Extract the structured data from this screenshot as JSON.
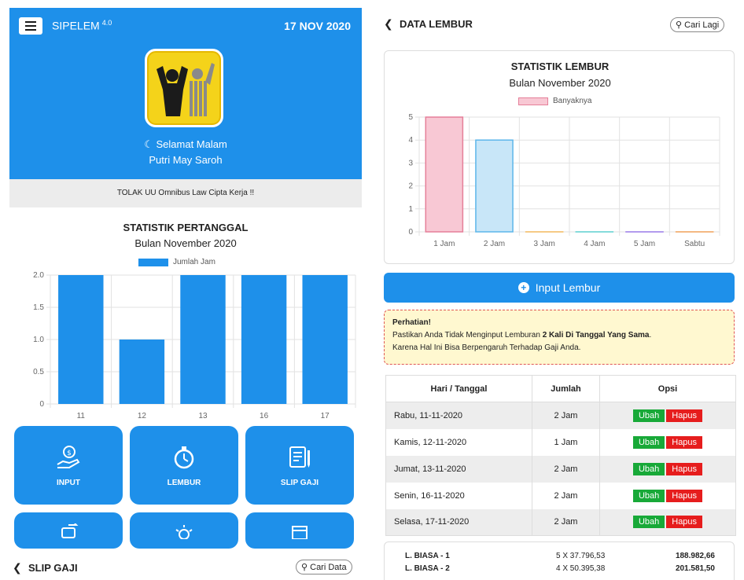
{
  "left": {
    "app_name": "SIPELEM",
    "app_version": "4.0",
    "date": "17 NOV 2020",
    "greeting": "Selamat Malam",
    "user_name": "Putri May Saroh",
    "banner": "TOLAK UU Omnibus Law Cipta Kerja !!",
    "tiles": [
      "INPUT",
      "LEMBUR",
      "SLIP GAJI"
    ],
    "slip_title": "SLIP GAJI",
    "search_label": "Cari Data"
  },
  "right": {
    "title": "DATA LEMBUR",
    "search_label": "Cari Lagi",
    "input_button": "Input Lembur",
    "warning": {
      "title": "Perhatian!",
      "text_before": "Pastikan Anda Tidak Menginput Lemburan ",
      "text_bold": "2 Kali Di Tanggal Yang Sama",
      "text_after": ".",
      "line2": "Karena Hal Ini Bisa Berpengaruh Terhadap Gaji Anda."
    },
    "table": {
      "headers": [
        "Hari / Tanggal",
        "Jumlah",
        "Opsi"
      ],
      "rows": [
        {
          "date": "Rabu, 11-11-2020",
          "amount": "2 Jam"
        },
        {
          "date": "Kamis, 12-11-2020",
          "amount": "1 Jam"
        },
        {
          "date": "Jumat, 13-11-2020",
          "amount": "2 Jam"
        },
        {
          "date": "Senin, 16-11-2020",
          "amount": "2 Jam"
        },
        {
          "date": "Selasa, 17-11-2020",
          "amount": "2 Jam"
        }
      ],
      "edit_label": "Ubah",
      "delete_label": "Hapus"
    },
    "summary": [
      {
        "label": "L. BIASA - 1",
        "calc": "5 X 37.796,53",
        "total": "188.982,66"
      },
      {
        "label": "L. BIASA - 2",
        "calc": "4 X 50.395,38",
        "total": "201.581,50"
      }
    ]
  },
  "colors": {
    "primary": "#1e90ea",
    "logo_yellow": "#f4d31a",
    "success": "#18a938",
    "danger": "#e61d1d",
    "bar_pink": "#f8c8d4",
    "bar_blue": "#c8e6f8"
  },
  "icons": {
    "menu": "hamburger-icon",
    "moon": "moon-icon",
    "back": "chevron-left-icon",
    "search": "search-icon",
    "plus": "plus-circle-icon",
    "tile_input": "money-hand-icon",
    "tile_lembur": "stopwatch-icon",
    "tile_slip": "document-pen-icon"
  },
  "chart_data": [
    {
      "type": "bar",
      "title": "STATISTIK PERTANGGAL",
      "subtitle": "Bulan November 2020",
      "categories": [
        "11",
        "12",
        "13",
        "16",
        "17"
      ],
      "series": [
        {
          "name": "Jumlah Jam",
          "values": [
            2,
            1,
            2,
            2,
            2
          ]
        }
      ],
      "yticks": [
        "0",
        "0.5",
        "1.0",
        "1.5",
        "2.0"
      ],
      "ylim": [
        0,
        2
      ],
      "grid": true,
      "legend": "top-center"
    },
    {
      "type": "bar",
      "title": "STATISTIK LEMBUR",
      "subtitle": "Bulan November 2020",
      "categories": [
        "1 Jam",
        "2 Jam",
        "3 Jam",
        "4 Jam",
        "5 Jam",
        "Sabtu"
      ],
      "series": [
        {
          "name": "Banyaknya",
          "values": [
            5,
            4,
            0,
            0,
            0,
            0
          ]
        }
      ],
      "yticks": [
        "0",
        "1",
        "2",
        "3",
        "4",
        "5"
      ],
      "ylim": [
        0,
        5
      ],
      "grid": true,
      "legend": "top-center"
    }
  ]
}
